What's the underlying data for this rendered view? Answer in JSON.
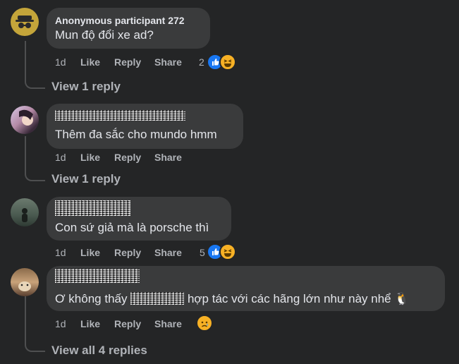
{
  "comments": [
    {
      "author": "Anonymous participant 272",
      "text": "Mun độ đổi xe ad?",
      "actions": {
        "time": "1d",
        "like": "Like",
        "reply": "Reply",
        "share": "Share"
      },
      "reaction_count": "2",
      "reactions": [
        "like-icon",
        "haha-icon"
      ],
      "view_replies": "View 1 reply"
    },
    {
      "text": "Thêm đa sắc cho mundo hmm",
      "actions": {
        "time": "1d",
        "like": "Like",
        "reply": "Reply",
        "share": "Share"
      },
      "view_replies": "View 1 reply"
    },
    {
      "text": "Con sứ giả mà là porsche thì",
      "actions": {
        "time": "1d",
        "like": "Like",
        "reply": "Reply",
        "share": "Share"
      },
      "reaction_count": "5",
      "reactions": [
        "like-icon",
        "haha-icon"
      ]
    },
    {
      "text_before": "Ơ không thấy",
      "text_after": "hợp tác với các hãng lớn như này nhể 🐧",
      "actions": {
        "time": "1d",
        "like": "Like",
        "reply": "Reply",
        "share": "Share"
      },
      "reactions": [
        "sad-icon"
      ],
      "view_replies": "View all 4 replies"
    }
  ],
  "colors": {
    "background": "#242526",
    "bubble": "#3a3b3c",
    "primary_text": "#e4e6eb",
    "secondary_text": "#b0b3b8",
    "like_blue": "#1877f2",
    "emoji_yellow": "#f7b125"
  }
}
